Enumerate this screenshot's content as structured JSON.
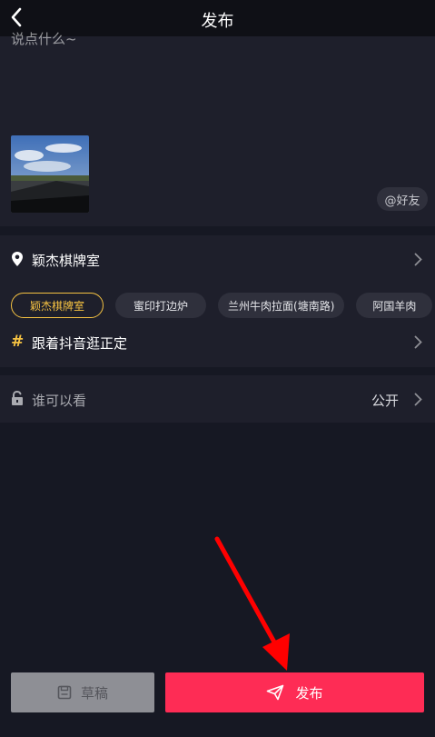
{
  "header": {
    "title": "发布",
    "back_icon": "chevron-left-icon"
  },
  "compose": {
    "caption_placeholder": "说点什么~",
    "at_friend_label": "@好友"
  },
  "location": {
    "selected": "颖杰棋牌室",
    "pin_icon": "location-pin-icon",
    "suggestions": [
      "颖杰棋牌室",
      "蜜印打边炉",
      "兰州牛肉拉面(塘南路)",
      "阿国羊肉"
    ]
  },
  "topic": {
    "label": "跟着抖音逛正定",
    "icon": "hashtag-icon"
  },
  "privacy": {
    "label": "谁可以看",
    "value": "公开",
    "icon": "unlock-icon"
  },
  "actions": {
    "draft_label": "草稿",
    "publish_label": "发布"
  },
  "colors": {
    "background": "#161823",
    "card": "#1e1f2b",
    "accent_yellow": "#f5c242",
    "publish_red": "#fe2c55",
    "annotation_arrow": "#ff0000"
  }
}
